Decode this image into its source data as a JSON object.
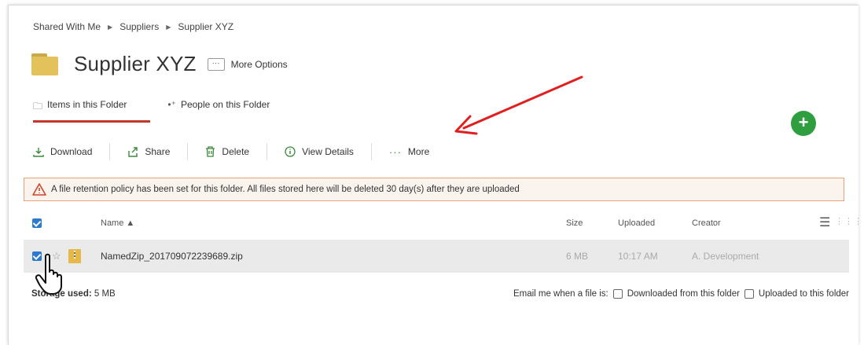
{
  "breadcrumb": {
    "items": [
      "Shared With Me",
      "Suppliers",
      "Supplier XYZ"
    ]
  },
  "header": {
    "title": "Supplier XYZ",
    "more_options_dots": "···",
    "more_options_label": "More Options"
  },
  "tabs": [
    {
      "label": "Items in this Folder",
      "icon": "folder-outline-icon",
      "active": true
    },
    {
      "label": "People on this Folder",
      "icon": "add-person-icon",
      "active": false
    }
  ],
  "fab": {
    "label": "+"
  },
  "toolbar": {
    "download": "Download",
    "share": "Share",
    "delete": "Delete",
    "view_details": "View Details",
    "more": "More",
    "more_dots": "···"
  },
  "notice": {
    "text": "A file retention policy has been set for this folder. All files stored here will be deleted 30 day(s) after they are uploaded"
  },
  "table": {
    "columns": {
      "name": "Name ▲",
      "size": "Size",
      "uploaded": "Uploaded",
      "creator": "Creator"
    },
    "rows": [
      {
        "name": "NamedZip_201709072239689.zip",
        "size": "6 MB",
        "uploaded": "10:17 AM",
        "creator": "A. Development",
        "checked": true
      }
    ]
  },
  "footer": {
    "storage_label": "Storage used:",
    "storage_value": "5 MB",
    "email_label": "Email me when a file is:",
    "option_downloaded": "Downloaded from this folder",
    "option_uploaded": "Uploaded to this folder"
  },
  "colors": {
    "accent_red": "#c0392b",
    "fab_green": "#2e9e3e",
    "checkbox_blue": "#2a7ad3",
    "folder_yellow": "#e3c25c",
    "notice_border": "#e8a27a",
    "annotation_arrow": "#e02020"
  }
}
